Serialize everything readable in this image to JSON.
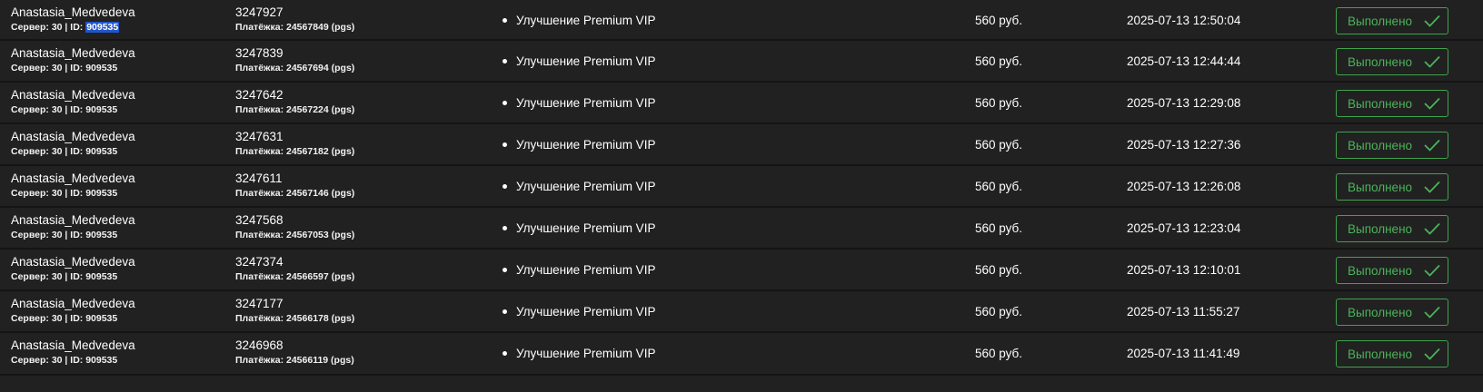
{
  "colors": {
    "background": "#212121",
    "row_divider": "#141414",
    "status_green": "#4cb35a",
    "selection_highlight": "#2255cc"
  },
  "rows": [
    {
      "user": "Anastasia_Medvedeva",
      "server_label": "Сервер: 30 | ID: ",
      "player_id": "909535",
      "order_id": "3247927",
      "payment": "Платёжка: 24567849 (pgs)",
      "product": "Улучшение Premium VIP",
      "price": "560 руб.",
      "datetime": "2025-07-13 12:50:04",
      "status": "Выполнено",
      "status_icon": "check-icon",
      "id_selected": true
    },
    {
      "user": "Anastasia_Medvedeva",
      "server_label": "Сервер: 30 | ID: ",
      "player_id": "909535",
      "order_id": "3247839",
      "payment": "Платёжка: 24567694 (pgs)",
      "product": "Улучшение Premium VIP",
      "price": "560 руб.",
      "datetime": "2025-07-13 12:44:44",
      "status": "Выполнено",
      "status_icon": "check-icon",
      "id_selected": false
    },
    {
      "user": "Anastasia_Medvedeva",
      "server_label": "Сервер: 30 | ID: ",
      "player_id": "909535",
      "order_id": "3247642",
      "payment": "Платёжка: 24567224 (pgs)",
      "product": "Улучшение Premium VIP",
      "price": "560 руб.",
      "datetime": "2025-07-13 12:29:08",
      "status": "Выполнено",
      "status_icon": "check-icon",
      "id_selected": false
    },
    {
      "user": "Anastasia_Medvedeva",
      "server_label": "Сервер: 30 | ID: ",
      "player_id": "909535",
      "order_id": "3247631",
      "payment": "Платёжка: 24567182 (pgs)",
      "product": "Улучшение Premium VIP",
      "price": "560 руб.",
      "datetime": "2025-07-13 12:27:36",
      "status": "Выполнено",
      "status_icon": "check-icon",
      "id_selected": false
    },
    {
      "user": "Anastasia_Medvedeva",
      "server_label": "Сервер: 30 | ID: ",
      "player_id": "909535",
      "order_id": "3247611",
      "payment": "Платёжка: 24567146 (pgs)",
      "product": "Улучшение Premium VIP",
      "price": "560 руб.",
      "datetime": "2025-07-13 12:26:08",
      "status": "Выполнено",
      "status_icon": "check-icon",
      "id_selected": false
    },
    {
      "user": "Anastasia_Medvedeva",
      "server_label": "Сервер: 30 | ID: ",
      "player_id": "909535",
      "order_id": "3247568",
      "payment": "Платёжка: 24567053 (pgs)",
      "product": "Улучшение Premium VIP",
      "price": "560 руб.",
      "datetime": "2025-07-13 12:23:04",
      "status": "Выполнено",
      "status_icon": "check-icon",
      "id_selected": false
    },
    {
      "user": "Anastasia_Medvedeva",
      "server_label": "Сервер: 30 | ID: ",
      "player_id": "909535",
      "order_id": "3247374",
      "payment": "Платёжка: 24566597 (pgs)",
      "product": "Улучшение Premium VIP",
      "price": "560 руб.",
      "datetime": "2025-07-13 12:10:01",
      "status": "Выполнено",
      "status_icon": "check-icon",
      "id_selected": false
    },
    {
      "user": "Anastasia_Medvedeva",
      "server_label": "Сервер: 30 | ID: ",
      "player_id": "909535",
      "order_id": "3247177",
      "payment": "Платёжка: 24566178 (pgs)",
      "product": "Улучшение Premium VIP",
      "price": "560 руб.",
      "datetime": "2025-07-13 11:55:27",
      "status": "Выполнено",
      "status_icon": "check-icon",
      "id_selected": false
    },
    {
      "user": "Anastasia_Medvedeva",
      "server_label": "Сервер: 30 | ID: ",
      "player_id": "909535",
      "order_id": "3246968",
      "payment": "Платёжка: 24566119 (pgs)",
      "product": "Улучшение Premium VIP",
      "price": "560 руб.",
      "datetime": "2025-07-13 11:41:49",
      "status": "Выполнено",
      "status_icon": "check-icon",
      "id_selected": false
    }
  ]
}
